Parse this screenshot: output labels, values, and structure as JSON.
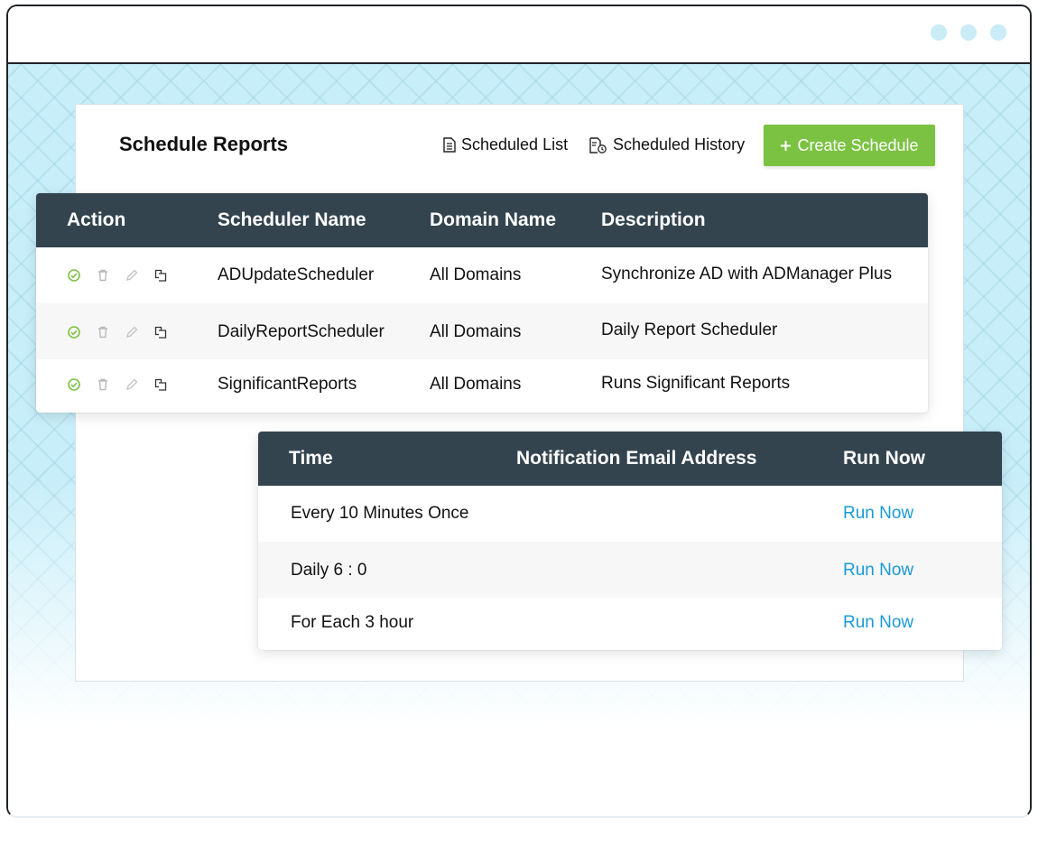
{
  "header": {
    "title": "Schedule Reports",
    "scheduled_list": "Scheduled List",
    "scheduled_history": "Scheduled History",
    "create_schedule": "Create Schedule",
    "create_icon": "plus-icon"
  },
  "schedulers": {
    "columns": [
      "Action",
      "Scheduler Name",
      "Domain Name",
      "Description"
    ],
    "rows": [
      {
        "name": "ADUpdateScheduler",
        "domain": "All Domains",
        "description": "Synchronize AD with ADManager Plus"
      },
      {
        "name": "DailyReportScheduler",
        "domain": "All Domains",
        "description": "Daily Report Scheduler"
      },
      {
        "name": "SignificantReports",
        "domain": "All Domains",
        "description": "Runs Significant Reports"
      }
    ],
    "action_icons": [
      "check-circle-icon",
      "trash-icon",
      "pencil-icon",
      "copy-icon"
    ]
  },
  "details": {
    "columns": [
      "Time",
      "Notification Email Address",
      "Run Now"
    ],
    "rows": [
      {
        "time": "Every 10 Minutes Once",
        "email": "",
        "run": "Run Now"
      },
      {
        "time": "Daily 6 : 0",
        "email": "",
        "run": "Run Now"
      },
      {
        "time": "For Each 3 hour",
        "email": "",
        "run": "Run Now"
      }
    ]
  },
  "colors": {
    "accent_green": "#7cc242",
    "table_header": "#33444f",
    "link_blue": "#1a9ad6",
    "backdrop": "#c8eef9"
  }
}
